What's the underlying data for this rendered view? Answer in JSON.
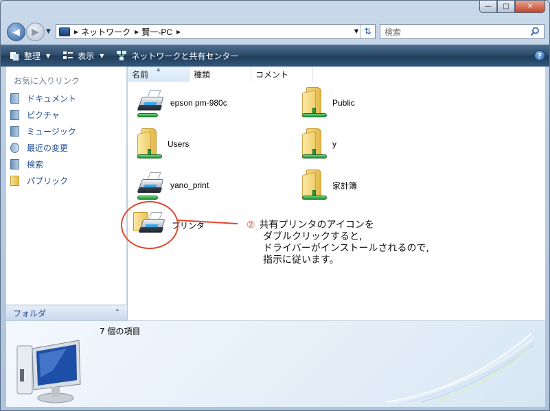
{
  "window": {
    "minimize_glyph": "—",
    "maximize_glyph": "□",
    "close_glyph": "✕"
  },
  "address": {
    "crumbs": [
      "ネットワーク",
      "賢一-PC"
    ]
  },
  "search": {
    "placeholder": "検索"
  },
  "toolbar": {
    "organize": "整理",
    "view": "表示",
    "network_center": "ネットワークと共有センター",
    "help": "?"
  },
  "favorites": {
    "title": "お気に入りリンク",
    "items": [
      {
        "label": "ドキュメント",
        "icon": "documents-icon"
      },
      {
        "label": "ピクチャ",
        "icon": "pictures-icon"
      },
      {
        "label": "ミュージック",
        "icon": "music-icon"
      },
      {
        "label": "最近の変更",
        "icon": "recent-icon"
      },
      {
        "label": "検索",
        "icon": "search-folder-icon"
      },
      {
        "label": "パブリック",
        "icon": "public-folder-icon"
      }
    ]
  },
  "folder_bar": {
    "label": "フォルダ"
  },
  "columns": [
    "名前",
    "種類",
    "コメント"
  ],
  "items": [
    {
      "label": "epson pm-980c",
      "type": "printer"
    },
    {
      "label": "Public",
      "type": "folder"
    },
    {
      "label": "Users",
      "type": "folder"
    },
    {
      "label": "y",
      "type": "folder"
    },
    {
      "label": "yano_print",
      "type": "printer"
    },
    {
      "label": "家計簿",
      "type": "folder"
    },
    {
      "label": "プリンタ",
      "type": "printers-folder"
    }
  ],
  "status": {
    "count_text": "7 個の項目"
  },
  "annotation": {
    "number": "②",
    "lines": [
      "共有プリンタのアイコンを",
      "ダブルクリックすると,",
      "ドライバーがインストールされるので,",
      "指示に従います。"
    ],
    "color": "#e0462a"
  }
}
